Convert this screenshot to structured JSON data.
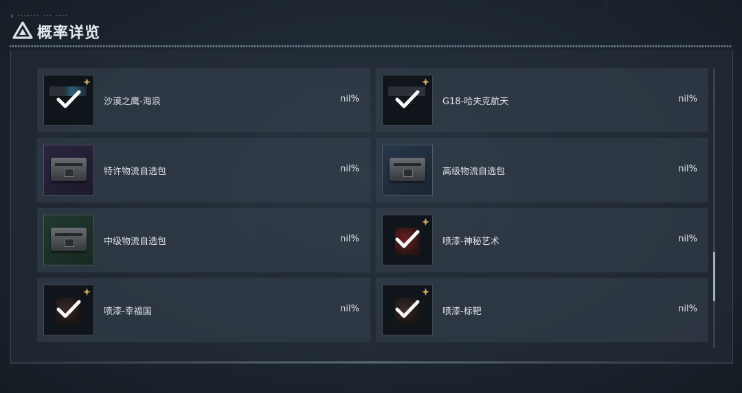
{
  "header": {
    "title": "概率详览",
    "caption": "▣ ••••••• ••• ••••",
    "logo_icon": "delta-logo-icon"
  },
  "colors": {
    "rank_gold": "#c9a55a",
    "check_white": "#ffffff"
  },
  "items": [
    {
      "name": "沙漠之鹰-海浪",
      "probability": "nil%",
      "thumb": "pistol",
      "owned": true,
      "rank_icon": "rank-emblem-icon",
      "bg": "dark"
    },
    {
      "name": "G18-哈夫克航天",
      "probability": "nil%",
      "thumb": "pistol",
      "owned": true,
      "rank_icon": "rank-emblem-icon",
      "bg": "dark"
    },
    {
      "name": "特许物流自选包",
      "probability": "nil%",
      "thumb": "crate",
      "owned": false,
      "bg": "purple"
    },
    {
      "name": "高级物流自选包",
      "probability": "nil%",
      "thumb": "crate",
      "owned": false,
      "bg": "blue"
    },
    {
      "name": "中级物流自选包",
      "probability": "nil%",
      "thumb": "crate",
      "owned": false,
      "bg": "green"
    },
    {
      "name": "喷漆-神秘艺术",
      "probability": "nil%",
      "thumb": "spray",
      "owned": true,
      "rank_icon": "rank-emblem-icon",
      "bg": "dark"
    },
    {
      "name": "喷漆-幸福国",
      "probability": "nil%",
      "thumb": "spray",
      "owned": true,
      "rank_icon": "rank-emblem-icon",
      "bg": "dark"
    },
    {
      "name": "喷漆-标靶",
      "probability": "nil%",
      "thumb": "spray",
      "owned": true,
      "rank_icon": "rank-emblem-icon",
      "bg": "dark"
    }
  ]
}
